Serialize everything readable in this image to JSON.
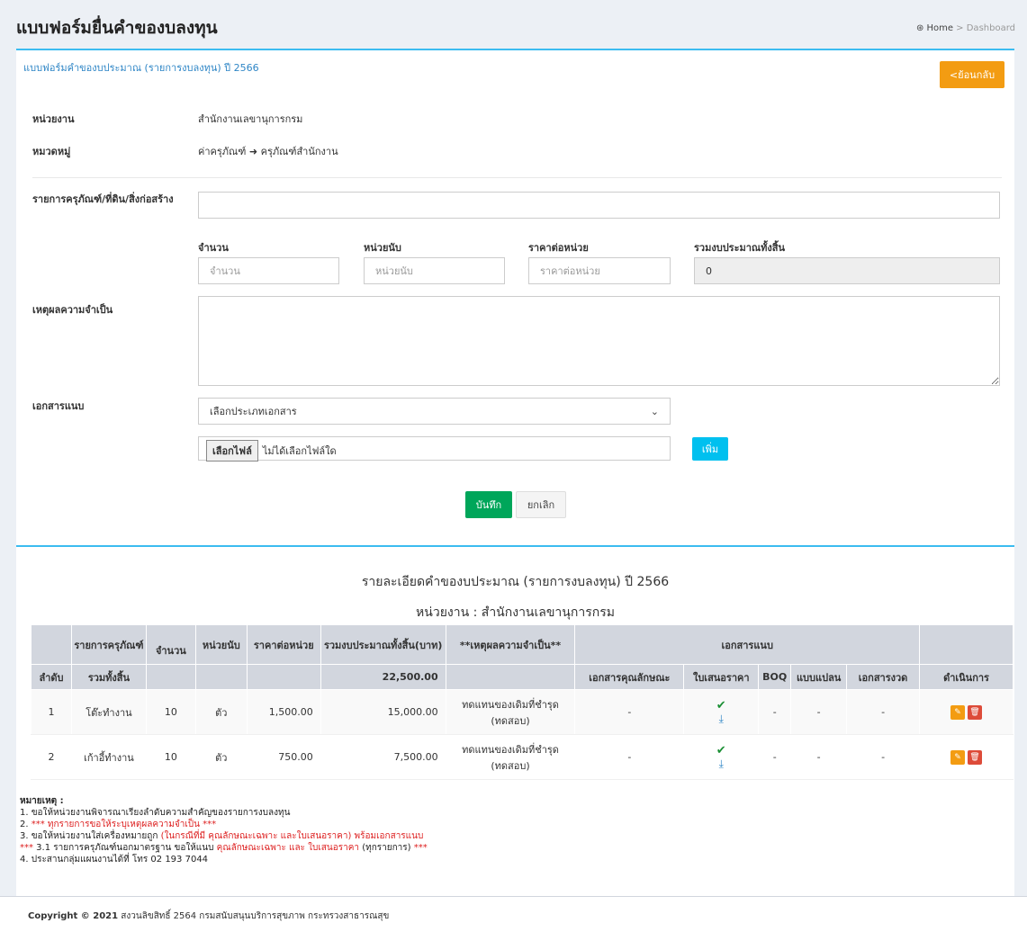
{
  "header": {
    "title": "แบบฟอร์มยื่นคำของบลงทุน",
    "breadcrumb_home": "Home",
    "breadcrumb_sep": ">",
    "breadcrumb_current": "Dashboard"
  },
  "form": {
    "box_title": "แบบฟอร์มคำของบประมาณ (รายการงบลงทุน) ปี 2566",
    "back_label": "<ย้อนกลับ",
    "unit_label": "หน่วยงาน",
    "unit_value": "สำนักงานเลขานุการกรม",
    "category_label": "หมวดหมู่",
    "category_value_a": "ค่าครุภัณฑ์",
    "category_arrow": "➜",
    "category_value_b": "ครุภัณฑ์สำนักงาน",
    "item_label": "รายการครุภัณฑ์/ที่ดิน/สิ่งก่อสร้าง",
    "item_value": "",
    "qty_label": "จำนวน",
    "qty_placeholder": "จำนวน",
    "uom_label": "หน่วยนับ",
    "uom_placeholder": "หน่วยนับ",
    "price_label": "ราคาต่อหน่วย",
    "price_placeholder": "ราคาต่อหน่วย",
    "total_label": "รวมงบประมาณทั้งสิ้น",
    "total_value": "0",
    "reason_label": "เหตุผลความจำเป็น",
    "reason_value": "",
    "attach_label": "เอกสารแนบ",
    "attach_select": "เลือกประเภทเอกสาร",
    "file_button": "เลือกไฟล์",
    "file_status": "ไม่ได้เลือกไฟล์ใด",
    "add_label": "เพิ่ม",
    "save_label": "บันทึก",
    "cancel_label": "ยกเลิก"
  },
  "report": {
    "title": "รายละเอียดคำของบประมาณ (รายการงบลงทุน) ปี 2566",
    "unit_line": "หน่วยงาน : สำนักงานเลขานุการกรม",
    "headers": {
      "seq": "ลำดับ",
      "item": "รายการครุภัณฑ์",
      "qty": "จำนวน",
      "uom": "หน่วยนับ",
      "price": "ราคาต่อหน่วย",
      "total": "รวมงบประมาณทั้งสิ้น(บาท)",
      "reason": "**เหตุผลความจำเป็น**",
      "attach": "เอกสารแนบ",
      "spec": "เอกสารคุณลักษณะ",
      "quote": "ใบเสนอราคา",
      "boq": "BOQ",
      "plan": "แบบแปลน",
      "installment": "เอกสารงวด",
      "actions": "ดำเนินการ"
    },
    "sum_label": "รวมทั้งสิ้น",
    "sum_value": "22,500.00",
    "rows": [
      {
        "seq": "1",
        "item": "โต๊ะทำงาน",
        "qty": "10",
        "uom": "ตัว",
        "price": "1,500.00",
        "total": "15,000.00",
        "reason": "ทดแทนของเดิมที่ชำรุด (ทดสอบ)",
        "spec": "-",
        "boq": "-",
        "plan": "-",
        "installment": "-"
      },
      {
        "seq": "2",
        "item": "เก้าอี้ทำงาน",
        "qty": "10",
        "uom": "ตัว",
        "price": "750.00",
        "total": "7,500.00",
        "reason": "ทดแทนของเดิมที่ชำรุด (ทดสอบ)",
        "spec": "-",
        "boq": "-",
        "plan": "-",
        "installment": "-"
      }
    ]
  },
  "notes": {
    "heading": "หมายเหตุ :",
    "n1": "1. ขอให้หน่วยงานพิจารณาเรียงลำดับความสำคัญของรายการงบลงทุน",
    "n2_prefix": "2. ",
    "n2_red": "*** ทุกรายการขอให้ระบุเหตุผลความจำเป็น ***",
    "n3_a": "3. ขอให้หน่วยงานใส่เครื่องหมายถูก ",
    "n3_red": "(ในกรณีที่มี คุณลักษณะเฉพาะ และใบเสนอราคา) พร้อมเอกสารแนบ",
    "n31_red_a": "***",
    "n31_b": " 3.1 รายการครุภัณฑ์นอกมาตรฐาน ขอให้แนบ ",
    "n31_red_c": "คุณลักษณะเฉพาะ และ ใบเสนอราคา",
    "n31_d": " (ทุกรายการ) ",
    "n31_red_e": "***",
    "n4": "4. ประสานกลุ่มแผนงานได้ที่ โทร 02 193 7044"
  },
  "footer": {
    "copyright_bold": "Copyright © 2021",
    "copyright_rest": " สงวนลิขสิทธิ์ 2564 กรมสนับสนุนบริการสุขภาพ กระทรวงสาธารณสุข"
  }
}
